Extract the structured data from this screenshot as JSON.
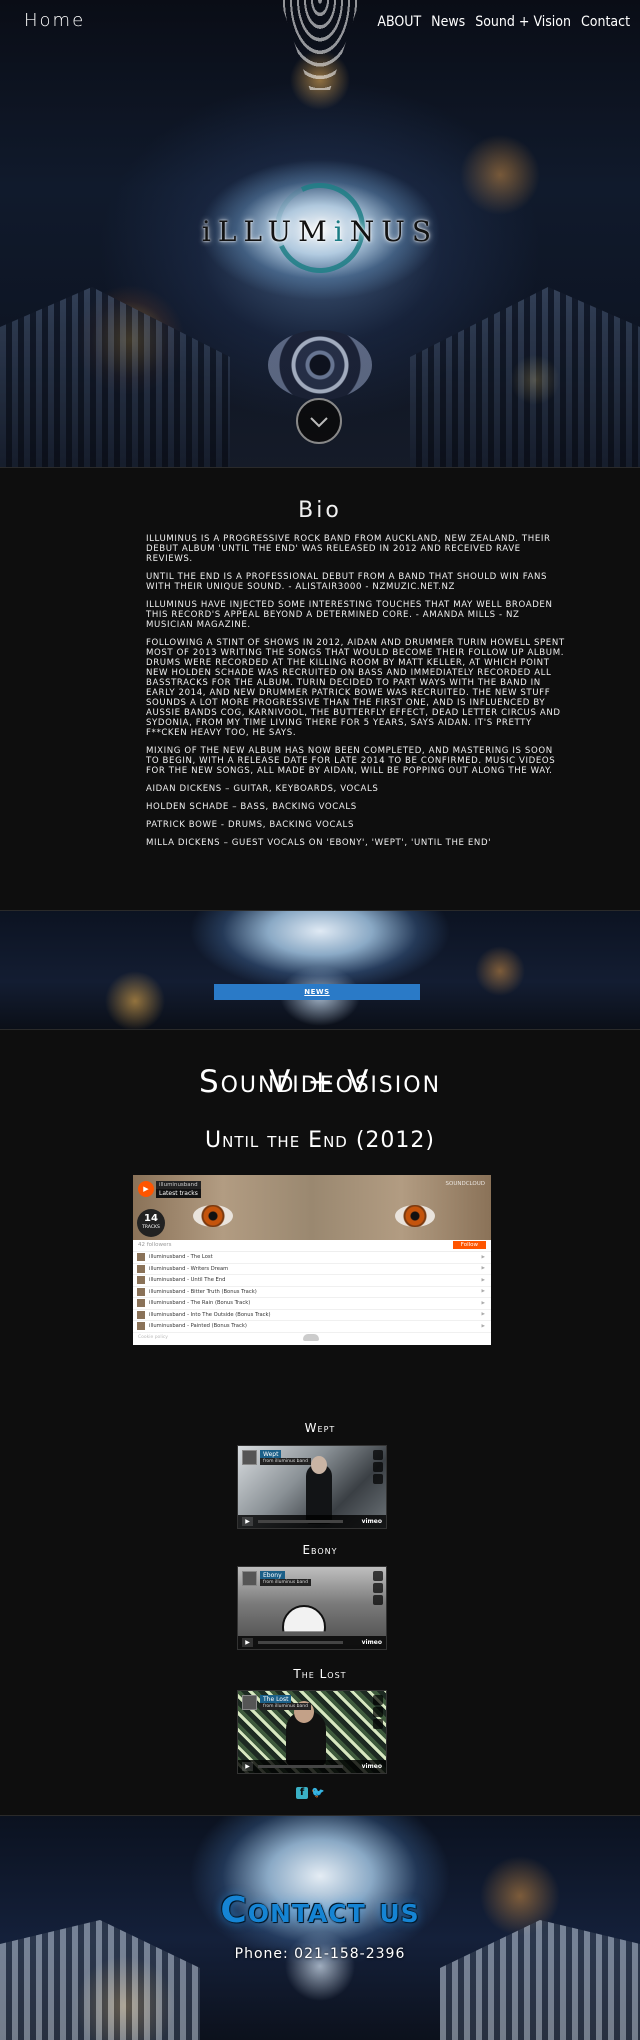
{
  "nav": {
    "home": "Home",
    "links": [
      "ABOUT",
      "News",
      "Sound + Vision",
      "Contact"
    ]
  },
  "hero": {
    "logo_pre": "iLLUM",
    "logo_mid": "i",
    "logo_post": "NUS"
  },
  "bio": {
    "title": "Bio",
    "paragraphs": [
      "Illuminus is a progressive rock band from Auckland, New Zealand. Their debut album 'Until the End' was released in 2012 and received rave reviews.",
      "Until the End is a professional debut from a band that should win fans with their unique sound. - Alistair3000 - nzmuzic.net.nz",
      "Illuminus have injected some interesting touches that may well broaden this record's appeal beyond a determined core. - Amanda Mills - NZ Musician Magazine.",
      "Following a stint of shows in 2012, Aidan and drummer Turin Howell spent most of 2013 writing the songs that would become their follow up album. Drums were recorded at The Killing Room by Matt Keller, at which point new Holden Schade was recruited on bass and immediately recorded all basstracks for the album. Turin decided to part ways with the band in early 2014, and new drummer Patrick Bowe was recruited. The new stuff sounds a lot more progressive than the first one, and is influenced by aussie bands Cog, Karnivool, The Butterfly Effect, Dead Letter Circus and Sydonia, from my time living there for 5 years, says Aidan. It's pretty f**cken heavy too, he says.",
      "Mixing of the new album has now been completed, and mastering is soon to begin, with a release date for late 2014 to be confirmed. Music videos for the new songs, all made by Aidan, will be popping out along the way.",
      "Aidan Dickens – Guitar, keyboards, vocals",
      "Holden Schade – Bass, backing vocals",
      "Patrick Bowe - Drums, backing vocals",
      "Milla Dickens – Guest vocals on 'Ebony', 'Wept', 'Until the End'"
    ]
  },
  "news": {
    "button": "NEWS"
  },
  "sound_vision": {
    "title": "Sound + Vision",
    "album": "Until the End (2012)",
    "soundcloud": {
      "label": "illuminusband",
      "tab": "Latest tracks",
      "brand": "SOUNDCLOUD",
      "track_count": "14",
      "tracks_word": "TRACKS",
      "followers": "42 followers",
      "follow": "Follow",
      "cookie": "Cookie policy",
      "tracks": [
        "illuminusband - The Lost",
        "illuminusband - Writers Dream",
        "illuminusband - Until The End",
        "illuminusband - Bitter Truth (Bonus Track)",
        "illuminusband - The Rain (Bonus Track)",
        "illuminusband - Into The Outside (Bonus Track)",
        "illuminusband - Painted (Bonus Track)"
      ]
    },
    "videos_title": "Videos",
    "videos": [
      {
        "title": "Wept",
        "player_title": "Wept",
        "player_sub": "from illuminus band"
      },
      {
        "title": "Ebony",
        "player_title": "Ebony",
        "player_sub": "from illuminus band"
      },
      {
        "title": "The Lost",
        "player_title": "The Lost",
        "player_sub": "from illuminus band"
      }
    ],
    "vimeo": "vimeo"
  },
  "contact": {
    "title": "Contact us",
    "phone": "Phone: 021-158-2396"
  },
  "colors": {
    "accent_blue": "#2a7ac7",
    "teal": "#1c7c84",
    "social": "#3ab0c5",
    "soundcloud_orange": "#ff5500"
  },
  "icons": [
    "chevron-down-icon",
    "facebook-icon",
    "twitter-icon",
    "play-icon",
    "soundcloud-icon"
  ]
}
